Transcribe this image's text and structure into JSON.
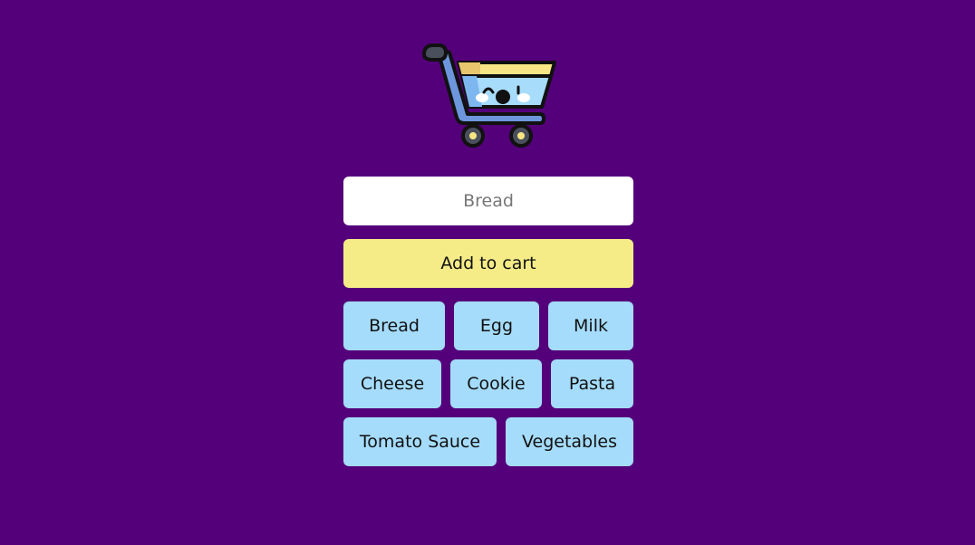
{
  "logo": {
    "icon": "shopping-cart-icon"
  },
  "input": {
    "placeholder": "Bread",
    "value": ""
  },
  "add_button": {
    "label": "Add to cart"
  },
  "colors": {
    "background": "#54007a",
    "button": "#f5ec88",
    "chip": "#a5dcfb"
  },
  "items": {
    "row1": [
      "Bread",
      "Egg",
      "Milk"
    ],
    "row2": [
      "Cheese",
      "Cookie",
      "Pasta"
    ],
    "row3": [
      "Tomato Sauce",
      "Vegetables"
    ]
  }
}
